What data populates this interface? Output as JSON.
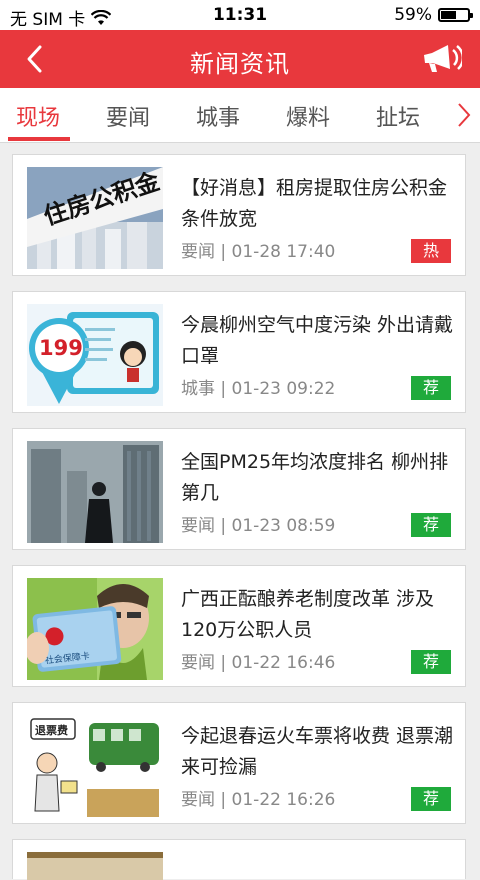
{
  "status_bar": {
    "carrier": "无 SIM 卡",
    "time": "11:31",
    "battery_percent": "59%",
    "battery_level": 0.59
  },
  "navbar": {
    "title": "新闻资讯",
    "back_icon": "chevron-left-icon",
    "speaker_icon": "megaphone-icon",
    "accent_color": "#e8383d"
  },
  "tabs": [
    {
      "label": "现场",
      "active": true
    },
    {
      "label": "要闻",
      "active": false
    },
    {
      "label": "城事",
      "active": false
    },
    {
      "label": "爆料",
      "active": false
    },
    {
      "label": "扯坛",
      "active": false
    }
  ],
  "news": [
    {
      "headline": "【好消息】租房提取住房公积金条件放宽",
      "category": "要闻",
      "date": "01-28 17:40",
      "badge": "热",
      "badge_type": "hot",
      "thumb_text": "住房公积金"
    },
    {
      "headline": "今晨柳州空气中度污染 外出请戴口罩",
      "category": "城事",
      "date": "01-23 09:22",
      "badge": "荐",
      "badge_type": "rec",
      "thumb_text": "199"
    },
    {
      "headline": "全国PM25年均浓度排名 柳州排第几",
      "category": "要闻",
      "date": "01-23 08:59",
      "badge": "荐",
      "badge_type": "rec",
      "thumb_text": ""
    },
    {
      "headline": "广西正酝酿养老制度改革  涉及120万公职人员",
      "category": "要闻",
      "date": "01-22 16:46",
      "badge": "荐",
      "badge_type": "rec",
      "thumb_text": "社会保障卡"
    },
    {
      "headline": "今起退春运火车票将收费 退票潮来可捡漏",
      "category": "要闻",
      "date": "01-22 16:26",
      "badge": "荐",
      "badge_type": "rec",
      "thumb_text": "退票费"
    }
  ]
}
